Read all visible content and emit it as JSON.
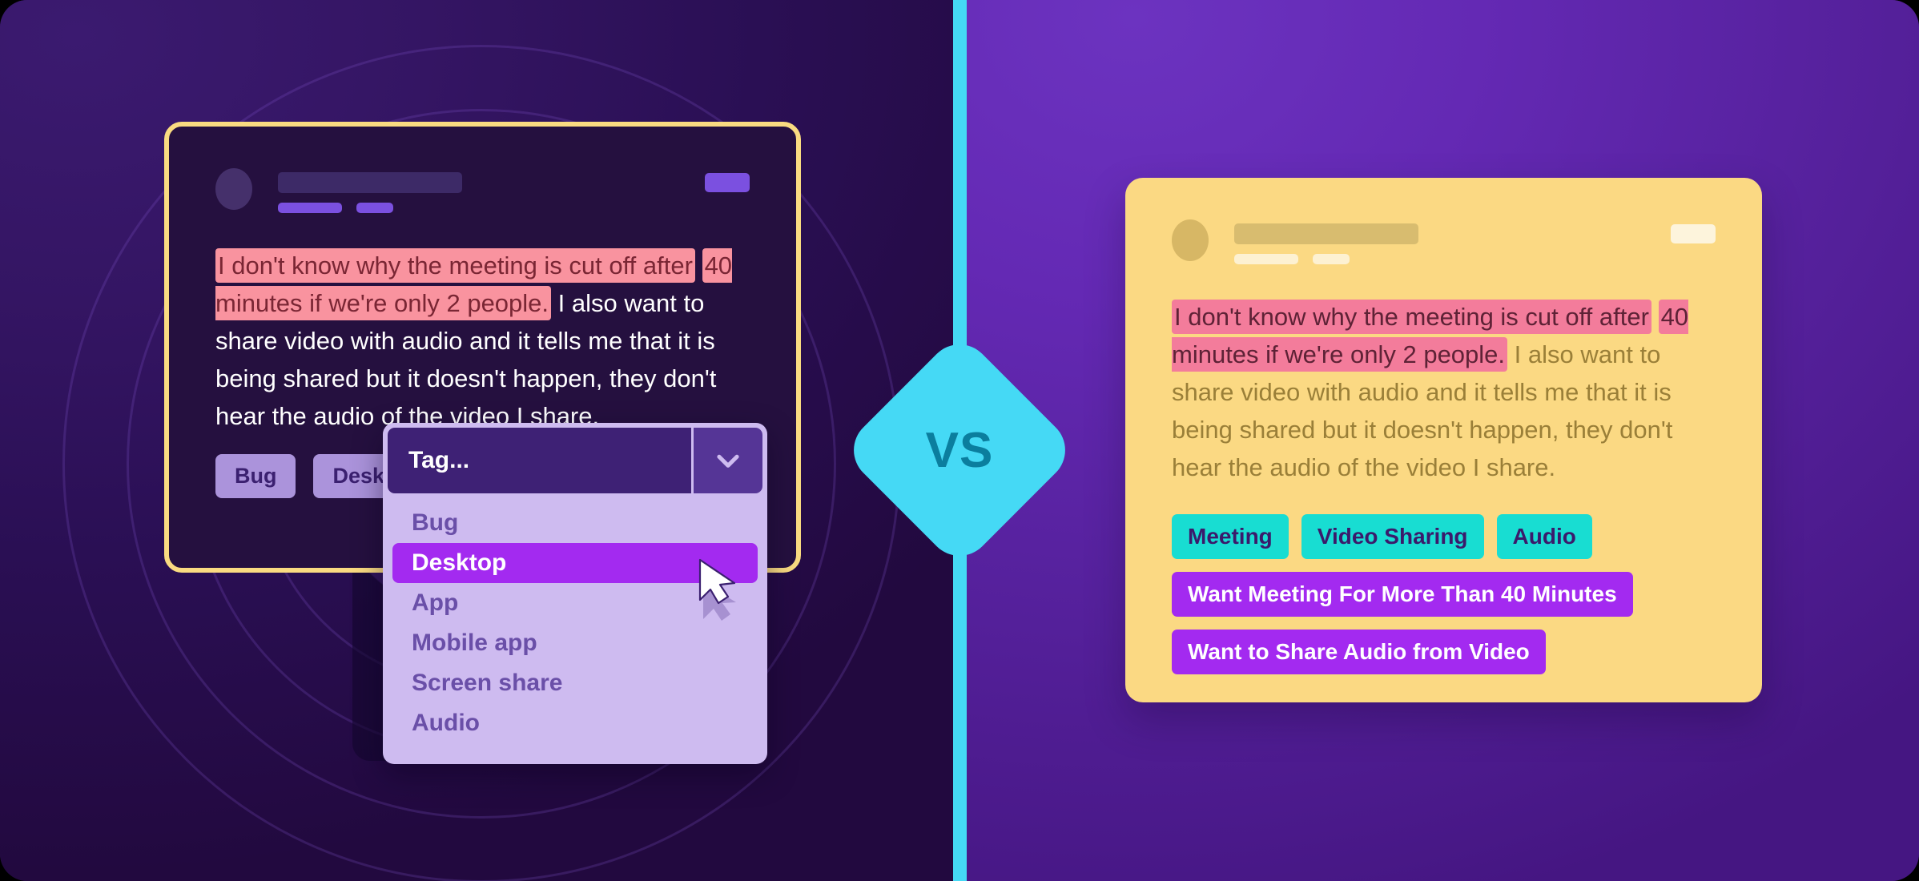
{
  "divider": {
    "label": "VS"
  },
  "left_card": {
    "header": {
      "avatar": "user-avatar",
      "badge": "status-badge"
    },
    "message": {
      "highlight_1": "I don't know why the meeting is cut off after",
      "highlight_2": "40 minutes if we're only 2 people.",
      "rest": " I also want to share video with audio and it tells me that it is being shared but it doesn't happen, they don't hear the audio of the video I share."
    },
    "pills": [
      "Bug",
      "Desktop"
    ],
    "dropdown": {
      "placeholder": "Tag...",
      "value": "Tag...",
      "arrow_icon": "chevron-down-icon",
      "selected": "Desktop",
      "options": [
        "Bug",
        "Desktop",
        "App",
        "Mobile app",
        "Screen share",
        "Audio"
      ]
    },
    "cursor_icon": "mouse-pointer-icon"
  },
  "right_card": {
    "header": {
      "avatar": "user-avatar",
      "badge": "status-badge"
    },
    "message": {
      "highlight_1": "I don't know why the meeting is cut off after",
      "highlight_2": "40 minutes if we're only 2 people.",
      "rest": " I also want to share video with audio and it tells me that it is being shared but it doesn't happen, they don't hear the audio of the video I share."
    },
    "tags_topic": [
      "Meeting",
      "Video Sharing",
      "Audio"
    ],
    "tags_intent": [
      "Want Meeting For More Than 40 Minutes",
      "Want to Share Audio from Video"
    ]
  },
  "colors": {
    "left_panel": "#2a0f54",
    "right_panel": "#6429b4",
    "accent_cyan": "#45D9F5",
    "card_yellow": "#FBD983",
    "card_border_yellow": "#FADB81",
    "highlight_pink_dark": "#F9939F",
    "highlight_pink_light": "#F37C9B",
    "tag_cyan": "#18DDD2",
    "tag_violet": "#A32AF0",
    "pill_lavender": "#AB93DB",
    "dropdown_bg": "#CEBBF0"
  }
}
